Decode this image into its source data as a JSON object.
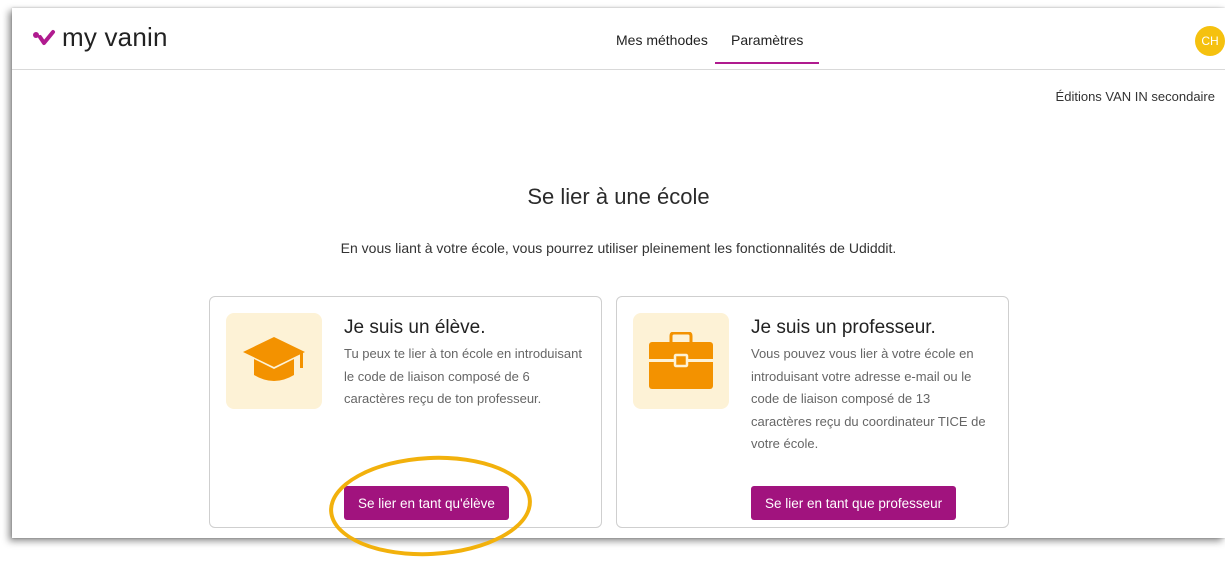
{
  "header": {
    "logo_text": "my vanin",
    "nav": [
      {
        "label": "Mes méthodes",
        "active": false
      },
      {
        "label": "Paramètres",
        "active": true
      }
    ],
    "avatar_initials": "CH"
  },
  "publisher": "Éditions VAN IN secondaire",
  "main": {
    "title": "Se lier à une école",
    "subtitle": "En vous liant à votre école, vous pourrez utiliser pleinement les fonctionnalités de Udiddit."
  },
  "cards": {
    "student": {
      "icon": "graduation-cap-icon",
      "title": "Je suis un élève.",
      "text": "Tu peux te lier à ton école en introduisant le code de liaison composé de 6 caractères reçu de ton professeur.",
      "button": "Se lier en tant qu'élève"
    },
    "teacher": {
      "icon": "briefcase-icon",
      "title": "Je suis un professeur.",
      "text": "Vous pouvez vous lier à votre école en introduisant votre adresse e-mail ou le code de liaison composé de 13 caractères reçu du coordinateur TICE de votre école.",
      "button": "Se lier en tant que professeur"
    }
  },
  "colors": {
    "accent": "#a1137e",
    "icon_orange": "#f39200",
    "icon_bg": "#fdf2d6",
    "avatar": "#f5c10f",
    "highlight": "#f2b10c"
  }
}
